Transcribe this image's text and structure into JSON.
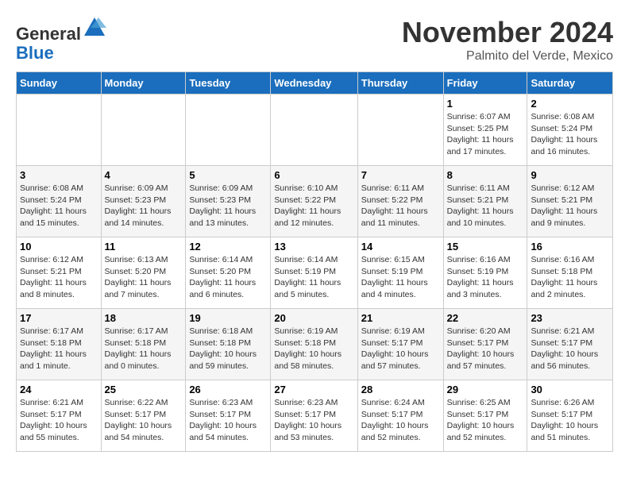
{
  "logo": {
    "general": "General",
    "blue": "Blue"
  },
  "header": {
    "month": "November 2024",
    "location": "Palmito del Verde, Mexico"
  },
  "weekdays": [
    "Sunday",
    "Monday",
    "Tuesday",
    "Wednesday",
    "Thursday",
    "Friday",
    "Saturday"
  ],
  "weeks": [
    [
      {
        "day": "",
        "info": ""
      },
      {
        "day": "",
        "info": ""
      },
      {
        "day": "",
        "info": ""
      },
      {
        "day": "",
        "info": ""
      },
      {
        "day": "",
        "info": ""
      },
      {
        "day": "1",
        "info": "Sunrise: 6:07 AM\nSunset: 5:25 PM\nDaylight: 11 hours and 17 minutes."
      },
      {
        "day": "2",
        "info": "Sunrise: 6:08 AM\nSunset: 5:24 PM\nDaylight: 11 hours and 16 minutes."
      }
    ],
    [
      {
        "day": "3",
        "info": "Sunrise: 6:08 AM\nSunset: 5:24 PM\nDaylight: 11 hours and 15 minutes."
      },
      {
        "day": "4",
        "info": "Sunrise: 6:09 AM\nSunset: 5:23 PM\nDaylight: 11 hours and 14 minutes."
      },
      {
        "day": "5",
        "info": "Sunrise: 6:09 AM\nSunset: 5:23 PM\nDaylight: 11 hours and 13 minutes."
      },
      {
        "day": "6",
        "info": "Sunrise: 6:10 AM\nSunset: 5:22 PM\nDaylight: 11 hours and 12 minutes."
      },
      {
        "day": "7",
        "info": "Sunrise: 6:11 AM\nSunset: 5:22 PM\nDaylight: 11 hours and 11 minutes."
      },
      {
        "day": "8",
        "info": "Sunrise: 6:11 AM\nSunset: 5:21 PM\nDaylight: 11 hours and 10 minutes."
      },
      {
        "day": "9",
        "info": "Sunrise: 6:12 AM\nSunset: 5:21 PM\nDaylight: 11 hours and 9 minutes."
      }
    ],
    [
      {
        "day": "10",
        "info": "Sunrise: 6:12 AM\nSunset: 5:21 PM\nDaylight: 11 hours and 8 minutes."
      },
      {
        "day": "11",
        "info": "Sunrise: 6:13 AM\nSunset: 5:20 PM\nDaylight: 11 hours and 7 minutes."
      },
      {
        "day": "12",
        "info": "Sunrise: 6:14 AM\nSunset: 5:20 PM\nDaylight: 11 hours and 6 minutes."
      },
      {
        "day": "13",
        "info": "Sunrise: 6:14 AM\nSunset: 5:19 PM\nDaylight: 11 hours and 5 minutes."
      },
      {
        "day": "14",
        "info": "Sunrise: 6:15 AM\nSunset: 5:19 PM\nDaylight: 11 hours and 4 minutes."
      },
      {
        "day": "15",
        "info": "Sunrise: 6:16 AM\nSunset: 5:19 PM\nDaylight: 11 hours and 3 minutes."
      },
      {
        "day": "16",
        "info": "Sunrise: 6:16 AM\nSunset: 5:18 PM\nDaylight: 11 hours and 2 minutes."
      }
    ],
    [
      {
        "day": "17",
        "info": "Sunrise: 6:17 AM\nSunset: 5:18 PM\nDaylight: 11 hours and 1 minute."
      },
      {
        "day": "18",
        "info": "Sunrise: 6:17 AM\nSunset: 5:18 PM\nDaylight: 11 hours and 0 minutes."
      },
      {
        "day": "19",
        "info": "Sunrise: 6:18 AM\nSunset: 5:18 PM\nDaylight: 10 hours and 59 minutes."
      },
      {
        "day": "20",
        "info": "Sunrise: 6:19 AM\nSunset: 5:18 PM\nDaylight: 10 hours and 58 minutes."
      },
      {
        "day": "21",
        "info": "Sunrise: 6:19 AM\nSunset: 5:17 PM\nDaylight: 10 hours and 57 minutes."
      },
      {
        "day": "22",
        "info": "Sunrise: 6:20 AM\nSunset: 5:17 PM\nDaylight: 10 hours and 57 minutes."
      },
      {
        "day": "23",
        "info": "Sunrise: 6:21 AM\nSunset: 5:17 PM\nDaylight: 10 hours and 56 minutes."
      }
    ],
    [
      {
        "day": "24",
        "info": "Sunrise: 6:21 AM\nSunset: 5:17 PM\nDaylight: 10 hours and 55 minutes."
      },
      {
        "day": "25",
        "info": "Sunrise: 6:22 AM\nSunset: 5:17 PM\nDaylight: 10 hours and 54 minutes."
      },
      {
        "day": "26",
        "info": "Sunrise: 6:23 AM\nSunset: 5:17 PM\nDaylight: 10 hours and 54 minutes."
      },
      {
        "day": "27",
        "info": "Sunrise: 6:23 AM\nSunset: 5:17 PM\nDaylight: 10 hours and 53 minutes."
      },
      {
        "day": "28",
        "info": "Sunrise: 6:24 AM\nSunset: 5:17 PM\nDaylight: 10 hours and 52 minutes."
      },
      {
        "day": "29",
        "info": "Sunrise: 6:25 AM\nSunset: 5:17 PM\nDaylight: 10 hours and 52 minutes."
      },
      {
        "day": "30",
        "info": "Sunrise: 6:26 AM\nSunset: 5:17 PM\nDaylight: 10 hours and 51 minutes."
      }
    ]
  ]
}
